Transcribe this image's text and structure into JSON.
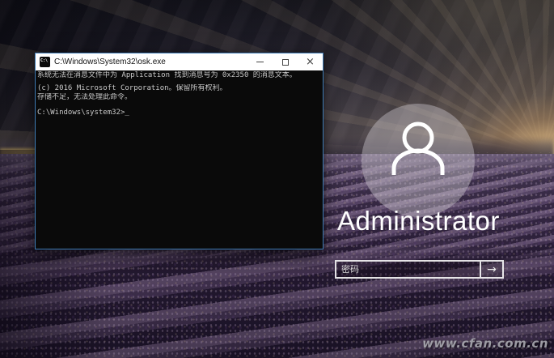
{
  "window": {
    "title": "C:\\Windows\\System32\\osk.exe",
    "icon_label": "C:\\",
    "close_glyph": "×",
    "controls": [
      "minimize",
      "maximize",
      "close"
    ]
  },
  "console": {
    "lines": [
      "系统无法在消息文件中为 Application 找到消息号为 0x2350 的消息文本。",
      "",
      "(c) 2016 Microsoft Corporation。保留所有权利。",
      "存储不足，无法处理此命令。",
      "",
      "C:\\Windows\\system32>"
    ],
    "cursor": "_"
  },
  "login": {
    "username": "Administrator",
    "password_placeholder": "密码",
    "submit_glyph": "→"
  },
  "watermark": "www.cfan.com.cn",
  "icons": {
    "app": "console-icon",
    "user": "person-outline-icon",
    "minimize": "minus-bar",
    "maximize": "square-outline",
    "close": "×",
    "submit": "→"
  },
  "colors": {
    "window_border": "#3f7cb5",
    "titlebar_bg": "#ffffff",
    "title_text": "#111111",
    "console_bg": "#0a0a0a",
    "console_text": "#c8c8c8",
    "username_text": "#ffffff",
    "password_border": "#ffffff",
    "sun_glow": "#f2c688",
    "watermark_text": "#b2b2b8"
  }
}
